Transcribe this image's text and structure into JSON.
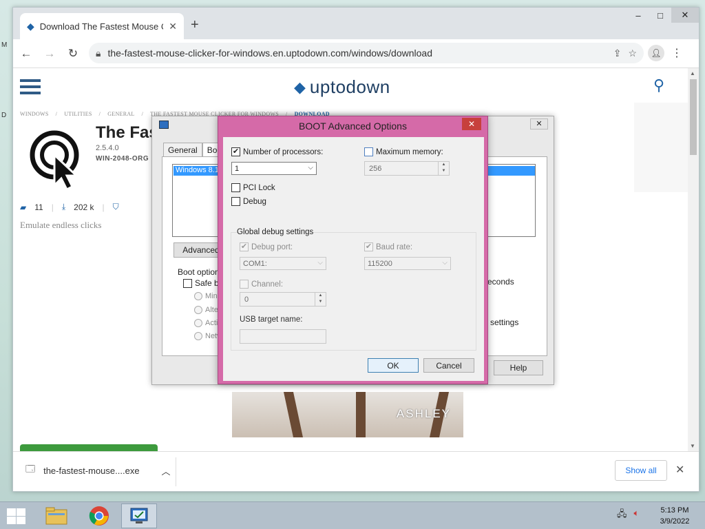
{
  "browser": {
    "tab_title": "Download The Fastest Mouse Cli",
    "url": "the-fastest-mouse-clicker-for-windows.en.uptodown.com/windows/download",
    "new_tab_glyph": "+",
    "window_controls": {
      "minimize": "–",
      "maximize": "□",
      "close": "✕"
    }
  },
  "site": {
    "logo_text": "uptodown",
    "breadcrumb": [
      "WINDOWS",
      "/",
      "UTILITIES",
      "/",
      "GENERAL",
      "/",
      "THE FASTEST MOUSE CLICKER FOR WINDOWS",
      "/",
      "DOWNLOAD"
    ],
    "app_title": "The Fas",
    "app_version": "2.5.4.0",
    "app_developer": "WIN-2048-ORG",
    "comments": "11",
    "downloads": "202 k",
    "tagline": "Emulate endless clicks",
    "ad_brand": "ASHLEY"
  },
  "downloads_shelf": {
    "file_name": "the-fastest-mouse....exe",
    "show_all": "Show all"
  },
  "msconfig": {
    "tabs": [
      "General",
      "Boot"
    ],
    "os_entry": "Windows 8.1",
    "advanced_button": "Advanced o",
    "boot_options_label": "Boot options",
    "safe_boot": "Safe bo",
    "radios": [
      "Mini",
      "Alte",
      "Activ",
      "Netw"
    ],
    "seconds_label": "econds",
    "settings_label": "settings",
    "help_button": "Help",
    "close_glyph": "✕"
  },
  "dialog": {
    "title": "BOOT Advanced Options",
    "close_glyph": "✕",
    "number_of_processors": {
      "label": "Number of processors:",
      "checked": true,
      "value": "1"
    },
    "maximum_memory": {
      "label": "Maximum memory:",
      "checked": false,
      "value": "256"
    },
    "pci_lock": {
      "label": "PCI Lock",
      "checked": false
    },
    "debug": {
      "label": "Debug",
      "checked": false
    },
    "global_debug_settings": "Global debug settings",
    "debug_port": {
      "label": "Debug port:",
      "checked": true,
      "value": "COM1:"
    },
    "baud_rate": {
      "label": "Baud rate:",
      "checked": true,
      "value": "115200"
    },
    "channel": {
      "label": "Channel:",
      "checked": false,
      "value": "0"
    },
    "usb_target_name": {
      "label": "USB target name:",
      "value": ""
    },
    "ok": "OK",
    "cancel": "Cancel"
  },
  "taskbar": {
    "time": "5:13 PM",
    "date": "3/9/2022",
    "items": [
      "file-explorer-icon",
      "chrome-icon",
      "msconfig-icon"
    ]
  },
  "colors": {
    "dialog_frame": "#d56aa8",
    "close_red": "#c7403c",
    "brand_blue": "#1f63a6",
    "download_green": "#3d9a3d",
    "selection_blue": "#3399ff"
  }
}
